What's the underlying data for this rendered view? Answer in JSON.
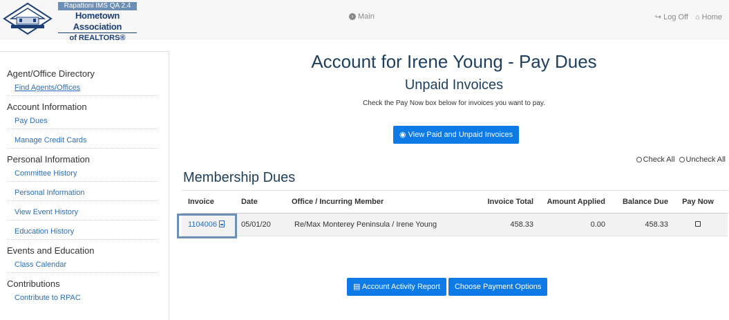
{
  "header": {
    "logo_qa": "Rapattoni IMS QA 2.4",
    "logo_name_line1": "Hometown Association",
    "logo_name_line2": "of REALTORS®",
    "nav_main": "Main",
    "nav_logoff": "Log Off",
    "nav_home": "Home"
  },
  "sidebar": {
    "sections": [
      {
        "title": "Agent/Office Directory",
        "links": [
          "Find Agents/Offices"
        ]
      },
      {
        "title": "Account Information",
        "links": [
          "Pay Dues",
          "Manage Credit Cards"
        ]
      },
      {
        "title": "Personal Information",
        "links": [
          "Committee History",
          "Personal Information",
          "View Event History",
          "Education History"
        ]
      },
      {
        "title": "Events and Education",
        "links": [
          "Class Calendar"
        ]
      },
      {
        "title": "Contributions",
        "links": [
          "Contribute to RPAC"
        ]
      }
    ]
  },
  "main": {
    "title": "Account for Irene Young - Pay Dues",
    "subtitle": "Unpaid Invoices",
    "instructions": "Check the Pay Now box below for invoices you want to pay.",
    "view_button": "View Paid and Unpaid Invoices",
    "check_all": "Check All",
    "uncheck_all": "Uncheck All",
    "section_title": "Membership Dues",
    "table": {
      "headers": [
        "Invoice",
        "Date",
        "Office / Incurring Member",
        "Invoice Total",
        "Amount Applied",
        "Balance Due",
        "Pay Now"
      ],
      "rows": [
        {
          "invoice": "1104006",
          "date": "05/01/20",
          "office_member": "Re/Max Monterey Peninsula / Irene Young",
          "invoice_total": "458.33",
          "amount_applied": "0.00",
          "balance_due": "458.33"
        }
      ]
    },
    "activity_report_button": "Account Activity Report",
    "payment_options_button": "Choose Payment Options"
  },
  "colors": {
    "primary_button": "#0d7ae6",
    "heading": "#1c3f5e",
    "link": "#2a6ebb",
    "highlight_border": "#6d8fb5"
  }
}
